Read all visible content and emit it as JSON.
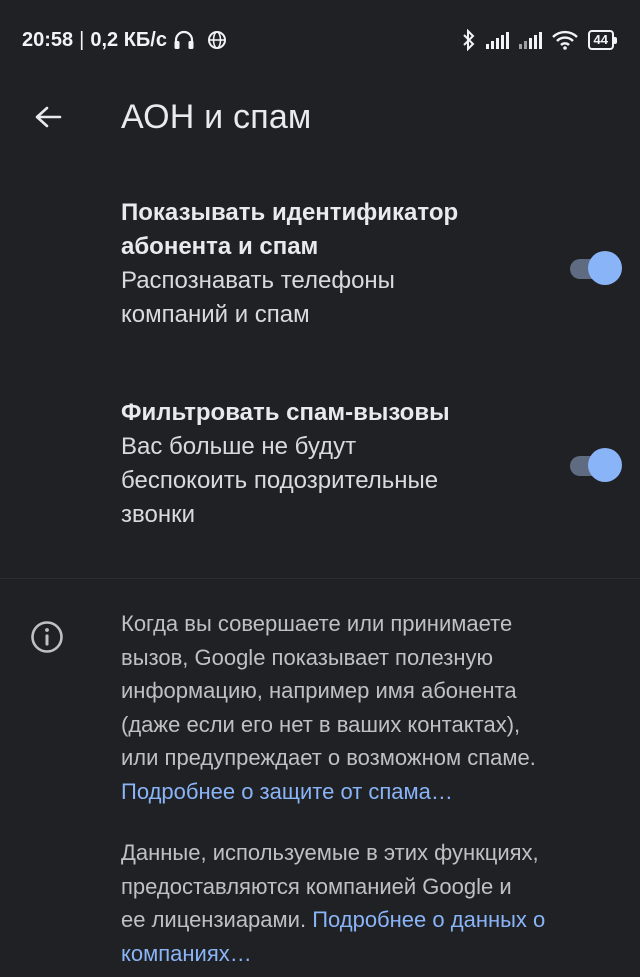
{
  "status_bar": {
    "time": "20:58",
    "separator": "|",
    "net_speed": "0,2 КБ/с",
    "headphones_icon": "headphones-icon",
    "vpn_icon": "globe-icon",
    "bluetooth_icon": "bluetooth-icon",
    "signal_icon": "cell-signal-icon",
    "wifi_icon": "wifi-icon",
    "battery_level": "44"
  },
  "app_bar": {
    "back_icon": "arrow-back-icon",
    "title": "АОН и спам"
  },
  "settings": [
    {
      "title_line1": "Показывать идентификатор",
      "title_line2": "абонента и спам",
      "summary_line1": "Распознавать телефоны",
      "summary_line2": "компаний и спам",
      "enabled": true
    },
    {
      "title_line1": "Фильтровать спам-вызовы",
      "summary_line1": "Вас больше не будут",
      "summary_line2": "беспокоить подозрительные",
      "summary_line3": "звонки",
      "enabled": true
    }
  ],
  "info": {
    "icon": "info-icon",
    "para1_lines": [
      "Когда вы совершаете или принимаете",
      "вызов, Google показывает полезную",
      "информацию, например имя абонента",
      "(даже если его нет в ваших контактах),",
      "или предупреждает о возможном спаме."
    ],
    "para1_link": "Подробнее о защите от спама…",
    "para2_line1": "Данные, используемые в этих функциях,",
    "para2_line2": "предоставляются компанией Google и",
    "para2_line3_text": "ее лицензиарами.",
    "para2_line3_link": "Подробнее о данных о",
    "para2_line4_link": "компаниях…"
  },
  "colors": {
    "background": "#202124",
    "accent": "#8ab4f8",
    "toggle_track": "#5f6b80",
    "text_primary": "#e8eaed",
    "text_secondary": "#bdc1c6"
  }
}
